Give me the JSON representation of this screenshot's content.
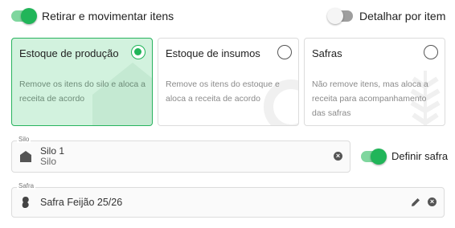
{
  "toggles": {
    "retirar": {
      "label": "Retirar e movimentar itens",
      "on": true
    },
    "detalhar": {
      "label": "Detalhar por item",
      "on": false
    },
    "definir_safra": {
      "label": "Definir safra",
      "on": true
    }
  },
  "cards": [
    {
      "title": "Estoque de produção",
      "description": "Remove os itens do silo e aloca a receita de acordo",
      "selected": true,
      "icon": "barn-icon"
    },
    {
      "title": "Estoque de insumos",
      "description": "Remove os itens do estoque e aloca a receita de acordo",
      "selected": false,
      "icon": "ring-icon"
    },
    {
      "title": "Safras",
      "description": "Não remove itens, mas aloca a receita para acompanhamento das safras",
      "selected": false,
      "icon": "wheat-icon"
    }
  ],
  "silo": {
    "legend": "Silo",
    "name": "Silo 1",
    "type": "Silo",
    "icon": "silo-icon",
    "clear_label": "×"
  },
  "safra": {
    "legend": "Safra",
    "value": "Safra Feijão 25/26",
    "icon": "bean-icon",
    "clear_label": "×"
  },
  "colors": {
    "accent": "#21b559",
    "selected_bg": "#d2f2de"
  }
}
